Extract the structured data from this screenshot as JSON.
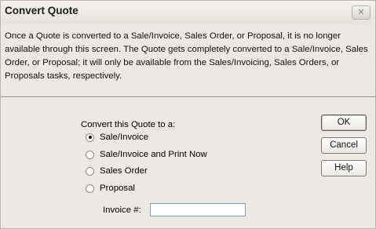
{
  "window": {
    "title": "Convert Quote",
    "close_glyph": "✕"
  },
  "description": "Once a Quote is converted to a Sale/Invoice, Sales Order, or Proposal, it is no longer available through this screen. The Quote gets completely converted to a Sale/Invoice, Sales Order, or Proposal; it will only be available from the Sales/Invoicing, Sales Orders, or Proposals tasks, respectively.",
  "convert_label": "Convert this Quote to a:",
  "options": [
    {
      "label": "Sale/Invoice",
      "selected": true
    },
    {
      "label": "Sale/Invoice and Print Now",
      "selected": false
    },
    {
      "label": "Sales Order",
      "selected": false
    },
    {
      "label": "Proposal",
      "selected": false
    }
  ],
  "invoice": {
    "label": "Invoice #:",
    "value": ""
  },
  "buttons": {
    "ok": "OK",
    "cancel": "Cancel",
    "help": "Help"
  }
}
